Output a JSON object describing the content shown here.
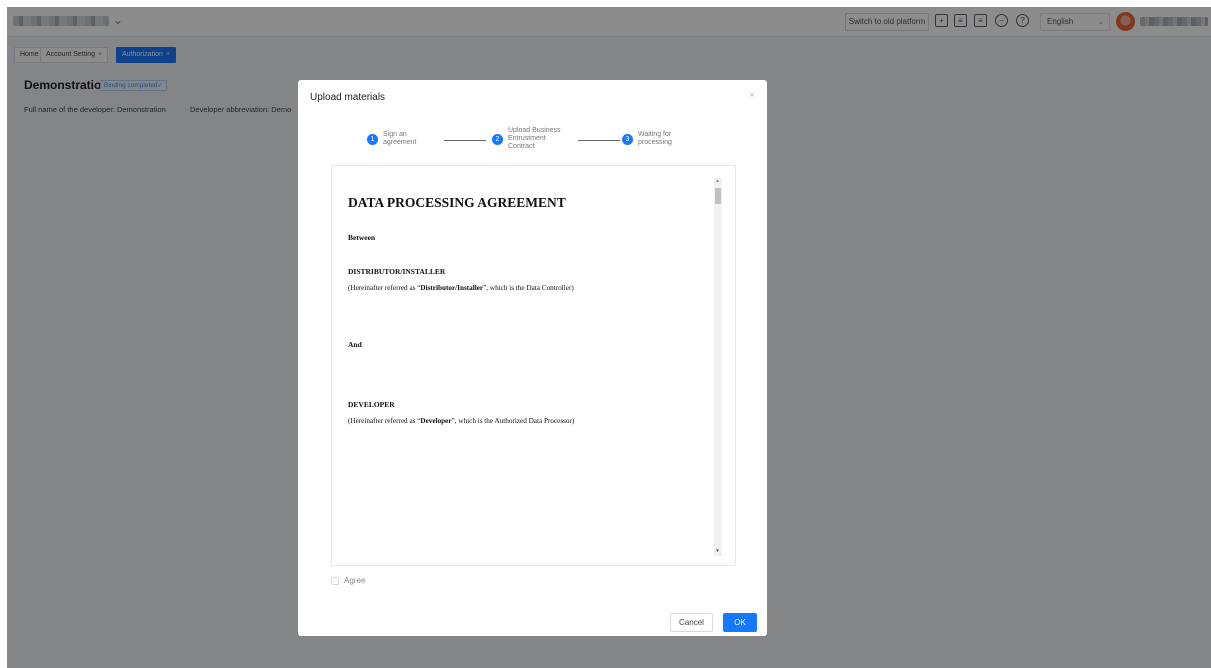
{
  "header": {
    "switch_platform_label": "Switch to old platform",
    "language": "English",
    "icons": [
      "plus-square-icon",
      "message-square-icon",
      "list-square-icon",
      "minus-circle-icon",
      "help-circle-icon"
    ]
  },
  "tabs": [
    {
      "label": "Home",
      "closable": false,
      "active": false
    },
    {
      "label": "Account Setting",
      "closable": true,
      "active": false
    },
    {
      "label": "Authorization",
      "closable": true,
      "active": true
    }
  ],
  "page": {
    "title": "Demonstration",
    "status_badge": "Binding completed",
    "full_name_label": "Full name of the developer: Demonstration",
    "abbreviation_label": "Developer abbreviation: Demo"
  },
  "modal": {
    "title": "Upload materials",
    "close_glyph": "×",
    "steps": [
      {
        "num": "1",
        "label_lines": [
          "Sign an",
          "agreement"
        ]
      },
      {
        "num": "2",
        "label_lines": [
          "Upload Business",
          "Entrustment",
          "Contract"
        ]
      },
      {
        "num": "3",
        "label_lines": [
          "Waiting for",
          "processing"
        ]
      }
    ],
    "document": {
      "heading": "DATA PROCESSING AGREEMENT",
      "between": "Between",
      "party1_name": "DISTRIBUTOR/INSTALLER",
      "party1_desc_pre": "(Hereinafter referred as “",
      "party1_desc_bold": "Distributor/Installer",
      "party1_desc_post": "”, which is the Data Controller)",
      "and": "And",
      "party2_name": "DEVELOPER",
      "party2_desc_pre": "(Hereinafter referred as “",
      "party2_desc_bold": "Developer",
      "party2_desc_post": "”, which is the Authorized Data Processor)"
    },
    "agree_label": "Agree",
    "agree_checked": false,
    "cancel_label": "Cancel",
    "ok_label": "OK"
  },
  "colors": {
    "accent": "#1677ff",
    "mask": "rgba(0,0,0,0.45)"
  }
}
